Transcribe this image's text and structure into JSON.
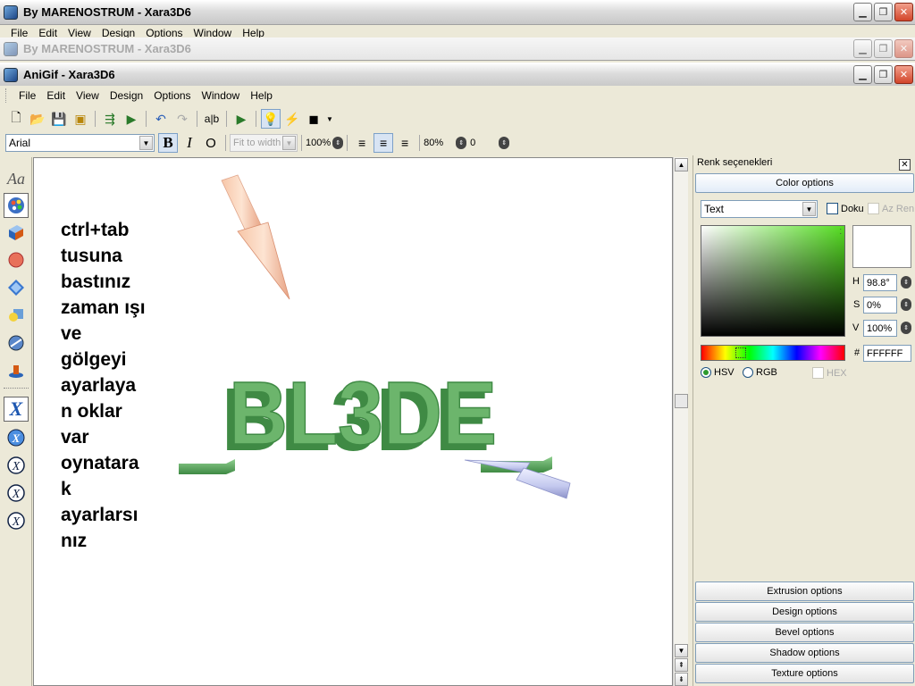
{
  "windows": {
    "back": {
      "title": "By MARENOSTRUM - Xara3D6",
      "menu": [
        "File",
        "Edit",
        "View",
        "Design",
        "Options",
        "Window",
        "Help"
      ]
    },
    "middle": {
      "title": "By MARENOSTRUM - Xara3D6"
    },
    "front": {
      "title": "AniGif - Xara3D6"
    }
  },
  "menu": [
    "File",
    "Edit",
    "View",
    "Design",
    "Options",
    "Window",
    "Help"
  ],
  "format_bar": {
    "font": "Arial",
    "fit": "Fit to width",
    "zoom": "100%",
    "spacing": "80%",
    "offset": "0"
  },
  "palette": {
    "text_tool": "Aa"
  },
  "canvas": {
    "lines": [
      "ctrl+tab",
      "tusuna",
      "bastınız",
      "zaman ışı",
      "ve",
      "gölgeyi",
      "ayarlaya",
      "n oklar",
      "var",
      "oynatara",
      "k",
      "ayarlarsı",
      "nız"
    ],
    "logo_text": "BL3DE"
  },
  "panel": {
    "header": "Renk seçenekleri",
    "color_options": "Color options",
    "target": "Text",
    "texture_label": "Doku",
    "az_label": "Az Ren",
    "h_label": "H",
    "h_value": "98.8°",
    "s_label": "S",
    "s_value": "0%",
    "v_label": "V",
    "v_value": "100%",
    "hex_prefix": "#",
    "hex_value": "FFFFFF",
    "mode_hsv": "HSV",
    "mode_rgb": "RGB",
    "mode_hex": "HEX",
    "sections": [
      "Extrusion options",
      "Design options",
      "Bevel options",
      "Shadow options",
      "Texture options"
    ]
  },
  "colors": {
    "logo_green": "#5ea65e",
    "swatch": "#ffffff"
  }
}
